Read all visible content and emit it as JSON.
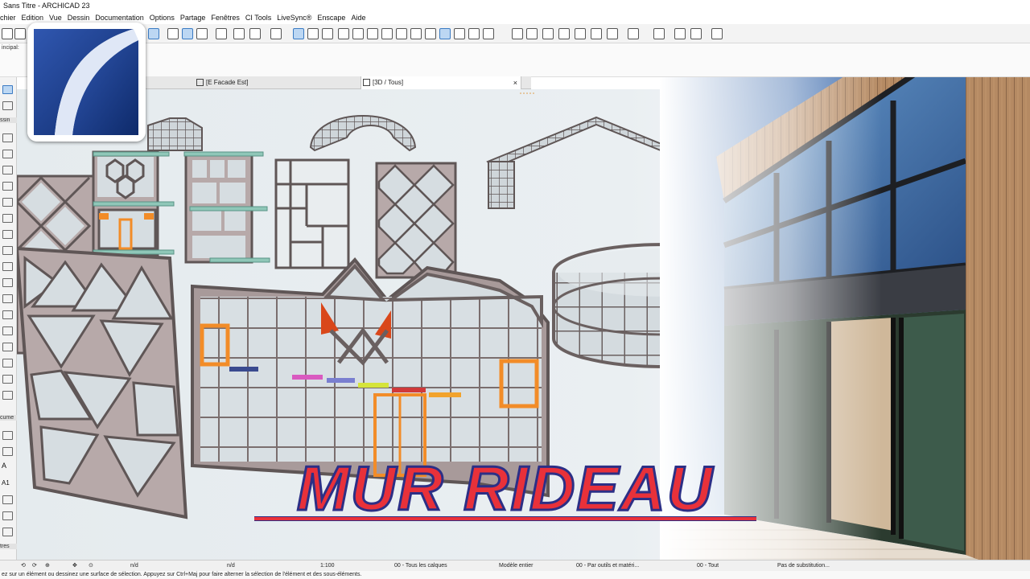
{
  "window": {
    "title": "Sans Titre - ARCHICAD 23"
  },
  "menu": [
    "chier",
    "Edition",
    "Vue",
    "Dessin",
    "Documentation",
    "Options",
    "Partage",
    "Fenêtres",
    "CI Tools",
    "LiveSync®",
    "Enscape",
    "Aide"
  ],
  "subbar": {
    "label": "incipal:"
  },
  "tabs": [
    {
      "label": "[E Facade Est]",
      "active": false
    },
    {
      "label": "[3D / Tous]",
      "active": true
    }
  ],
  "tab_close": "×",
  "left_sections": [
    {
      "label": "ssin"
    },
    {
      "label": "cume"
    },
    {
      "label": "tres"
    }
  ],
  "left_tool_labels": [
    "A1",
    "A"
  ],
  "banner": {
    "text": "MUR RIDEAU",
    "color": "#e8313a",
    "outline": "#2c2f86"
  },
  "status": {
    "nd1": "n/d",
    "nd2": "n/d",
    "scale": "1:100",
    "layers": "00 - Tous les calques",
    "model": "Modèle entier",
    "override": "00 - Par outils et matéri...",
    "renovation": "00 - Tout",
    "substitution": "Pas de substitution..."
  },
  "hint": "ez sur un élément ou dessinez une surface de sélection. Appuyez sur Ctrl+Maj pour faire alterner la sélection de l'élément et des sous-éléments.",
  "colors": {
    "panel_fill": "#b7a9a9",
    "frame": "#5f5656",
    "glass": "#d6dde1",
    "canvas_bg": "#e6ebee",
    "highlight_orange": "#f28c28",
    "triangle_orange": "#d9471a"
  }
}
